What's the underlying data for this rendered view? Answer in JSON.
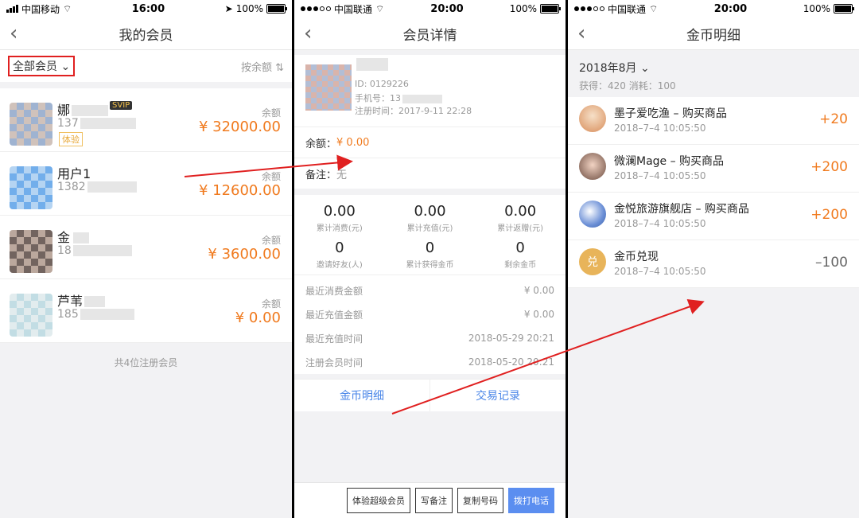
{
  "panel1": {
    "status": {
      "carrier": "中国移动",
      "time": "16:00",
      "battery": "100%"
    },
    "nav_title": "我的会员",
    "filter_label": "全部会员",
    "sort_label": "按余额",
    "balance_label": "余额",
    "members": [
      {
        "name": "娜",
        "phone": "137",
        "badge": "SVIP",
        "tag": "体验",
        "balance": "¥ 32000.00"
      },
      {
        "name": "用户1",
        "phone": "1382",
        "balance": "¥ 12600.00"
      },
      {
        "name": "金",
        "phone": "18",
        "balance": "¥ 3600.00"
      },
      {
        "name": "芦苇",
        "phone": "185",
        "balance": "¥ 0.00"
      }
    ],
    "footer": "共4位注册会员"
  },
  "panel2": {
    "status": {
      "carrier": "中国联通",
      "time": "20:00",
      "battery": "100%"
    },
    "nav_title": "会员详情",
    "profile": {
      "id": "ID: 0129226",
      "phone": "手机号：13",
      "reg": "注册时间：2017-9-11 22:28"
    },
    "balance_label": "余额：",
    "balance_value": "¥ 0.00",
    "remark_label": "备注：",
    "remark_value": "无",
    "stats": [
      {
        "value": "0.00",
        "label": "累计消费(元)"
      },
      {
        "value": "0.00",
        "label": "累计充值(元)"
      },
      {
        "value": "0.00",
        "label": "累计返赠(元)"
      },
      {
        "value": "0",
        "label": "邀请好友(人)"
      },
      {
        "value": "0",
        "label": "累计获得金币"
      },
      {
        "value": "0",
        "label": "剩余金币"
      }
    ],
    "details": [
      {
        "k": "最近消费金额",
        "v": "¥ 0.00"
      },
      {
        "k": "最近充值金额",
        "v": "¥ 0.00"
      },
      {
        "k": "最近充值时间",
        "v": "2018-05-29 20:21"
      },
      {
        "k": "注册会员时间",
        "v": "2018-05-20 20:21"
      }
    ],
    "tabs": [
      "金币明细",
      "交易记录"
    ],
    "actions": [
      "体验超级会员",
      "写备注",
      "复制号码",
      "拨打电话"
    ]
  },
  "panel3": {
    "status": {
      "carrier": "中国联通",
      "time": "20:00",
      "battery": "100%"
    },
    "nav_title": "金币明细",
    "month": "2018年8月",
    "summary": "获得：420  消耗：100",
    "transactions": [
      {
        "title": "墨子爱吃渔 – 购买商品",
        "time": "2018–7–4 10:05:50",
        "amount": "+20"
      },
      {
        "title": "微澜Mage – 购买商品",
        "time": "2018–7–4 10:05:50",
        "amount": "+200"
      },
      {
        "title": "金悦旅游旗舰店 – 购买商品",
        "time": "2018–7–4 10:05:50",
        "amount": "+200"
      },
      {
        "title": "金币兑现",
        "time": "2018–7–4 10:05:50",
        "amount": "–100",
        "icon_text": "兑"
      }
    ]
  },
  "colors": {
    "accent": "#f07a1e",
    "link": "#4a86e8",
    "primary_button": "#5b8ef0",
    "annotation": "#e02020"
  }
}
